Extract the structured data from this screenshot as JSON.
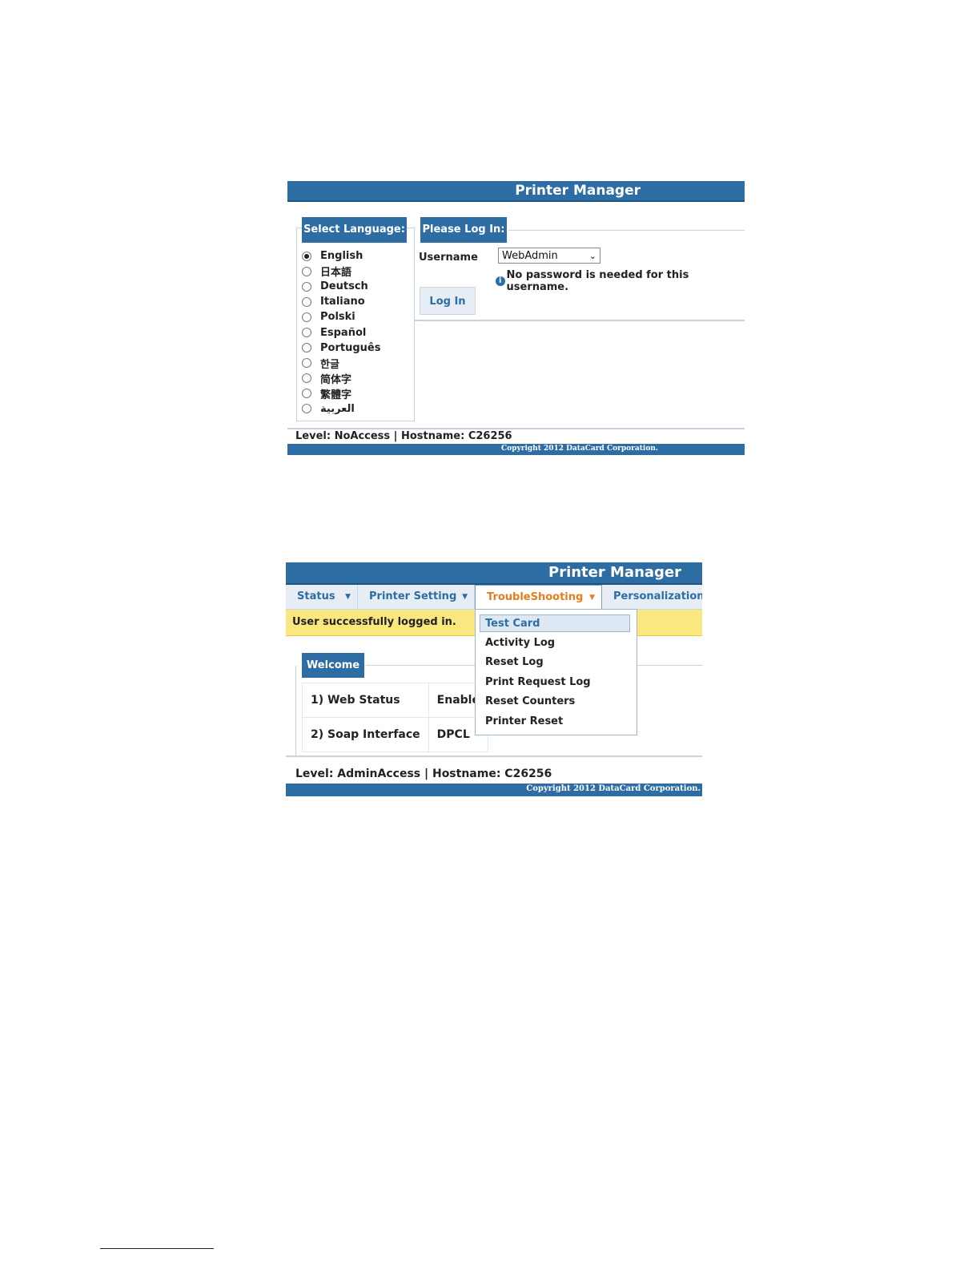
{
  "login_screen": {
    "title": "Printer Manager",
    "language_header": "Select Language:",
    "languages": [
      {
        "label": "English",
        "selected": true
      },
      {
        "label": "日本語",
        "selected": false
      },
      {
        "label": "Deutsch",
        "selected": false
      },
      {
        "label": "Italiano",
        "selected": false
      },
      {
        "label": "Polski",
        "selected": false
      },
      {
        "label": "Español",
        "selected": false
      },
      {
        "label": "Português",
        "selected": false
      },
      {
        "label": "한글",
        "selected": false
      },
      {
        "label": "简体字",
        "selected": false
      },
      {
        "label": "繁體字",
        "selected": false
      },
      {
        "label": "العربية",
        "selected": false
      }
    ],
    "login_header": "Please Log In:",
    "username_label": "Username",
    "username_value": "WebAdmin",
    "info_text": "No password is needed for this username.",
    "login_button": "Log In",
    "status": "Level: NoAccess | Hostname: C26256",
    "copyright": "Copyright 2012 DataCard Corporation."
  },
  "admin_screen": {
    "title": "Printer Manager",
    "nav": [
      {
        "label": "Status"
      },
      {
        "label": "Printer Setting"
      },
      {
        "label": "TroubleShooting"
      },
      {
        "label": "Personalization"
      }
    ],
    "notice": "User successfully logged in.",
    "welcome_header": "Welcome",
    "rows": [
      {
        "key": "1) Web Status",
        "value": "Enabled"
      },
      {
        "key": "2) Soap Interface",
        "value": "DPCL"
      }
    ],
    "menu": [
      "Test Card",
      "Activity Log",
      "Reset Log",
      "Print Request Log",
      "Reset Counters",
      "Printer Reset"
    ],
    "status": "Level: AdminAccess | Hostname: C26256",
    "copyright": "Copyright 2012 DataCard Corporation."
  },
  "colors": {
    "brand": "#2e6da4",
    "active_tab": "#e87d1e",
    "notice_bg": "#fbe77f"
  }
}
